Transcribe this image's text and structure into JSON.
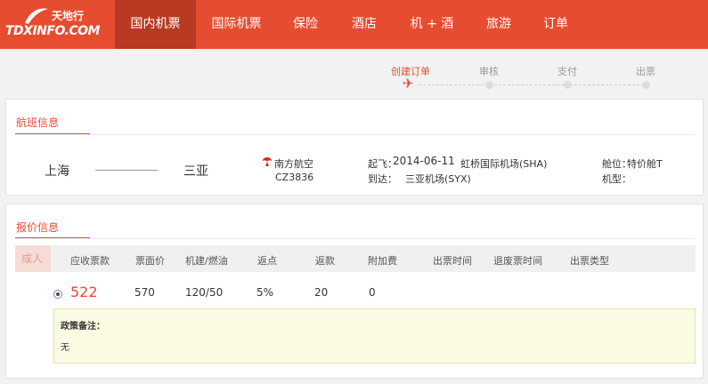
{
  "header": {
    "logo_text": "TDXINFO.COM",
    "logo_cn": "天地行",
    "nav": [
      {
        "label": "国内机票",
        "active": true
      },
      {
        "label": "国际机票",
        "active": false
      },
      {
        "label": "保险",
        "active": false
      },
      {
        "label": "酒店",
        "active": false
      },
      {
        "label": "机 + 酒",
        "active": false
      },
      {
        "label": "旅游",
        "active": false
      },
      {
        "label": "订单",
        "active": false
      }
    ]
  },
  "steps": [
    {
      "label": "创建订单",
      "active": true
    },
    {
      "label": "审核",
      "active": false
    },
    {
      "label": "支付",
      "active": false
    },
    {
      "label": "出票",
      "active": false
    }
  ],
  "flight": {
    "section_title": "航班信息",
    "from_city": "上海",
    "to_city": "三亚",
    "airline": "南方航空",
    "flight_no": "CZ3836",
    "depart_label": "起飞：",
    "depart_date": "2014-06-11",
    "depart_airport": "虹桥国际机场(SHA)",
    "arrive_label": "到达：",
    "arrive_airport": "三亚机场(SYX)",
    "cabin_label": "舱位：",
    "cabin_value": "特价舱T",
    "aircraft_label": "机型："
  },
  "pricing": {
    "section_title": "报价信息",
    "passenger_type": "成人",
    "headers": [
      "应收票款",
      "票面价",
      "机建/燃油",
      "返点",
      "返款",
      "附加费",
      "出票时间",
      "退废票时间",
      "出票类型"
    ],
    "row": {
      "receivable": "522",
      "face_price": "570",
      "tax_fuel": "120/50",
      "rebate_point": "5%",
      "rebate_amount": "20",
      "surcharge": "0"
    },
    "note_title": "政策备注：",
    "note_text": "无"
  },
  "colors": {
    "brand": "#e64c30",
    "brand_dark": "#b83a22"
  }
}
